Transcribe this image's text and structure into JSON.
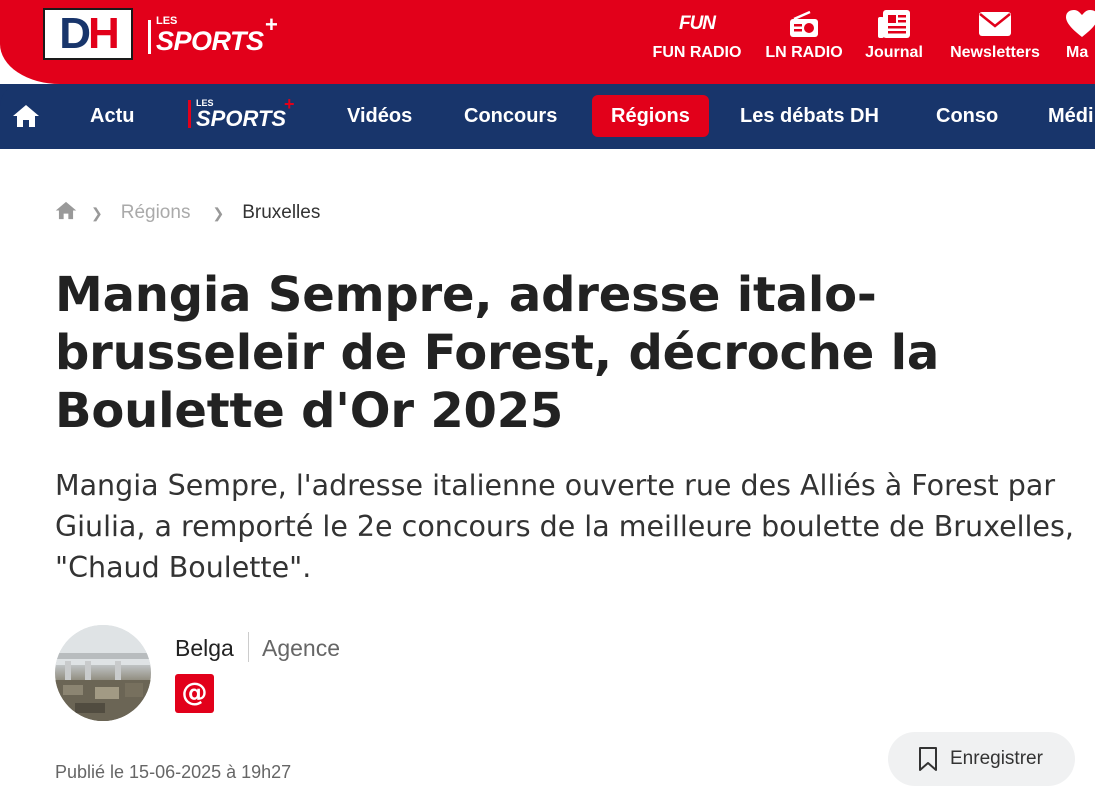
{
  "brand": {
    "logo_text": "DH",
    "sports_les": "LES",
    "sports_name": "SPORTS",
    "sports_plus": "+"
  },
  "colors": {
    "primary_red": "#e2001a",
    "navy": "#18356b"
  },
  "top_links": [
    {
      "label": "FUN RADIO",
      "icon": "fun-radio-logo-icon",
      "icon_text": "FUN"
    },
    {
      "label": "LN RADIO",
      "icon": "radio-icon"
    },
    {
      "label": "Journal",
      "icon": "newspaper-icon"
    },
    {
      "label": "Newsletters",
      "icon": "envelope-icon"
    },
    {
      "label": "Ma",
      "icon": "heart-icon"
    }
  ],
  "nav": {
    "items": [
      "Actu",
      "Vidéos",
      "Concours",
      "Régions",
      "Les débats DH",
      "Conso",
      "Médi"
    ],
    "active": "Régions"
  },
  "breadcrumb": {
    "items": [
      "Régions",
      "Bruxelles"
    ]
  },
  "article": {
    "title": "Mangia Sempre, adresse italo-brusseleir de Forest, décroche la Boulette d'Or 2025",
    "lead": "Mangia Sempre, l'adresse italienne ouverte rue des Alliés à Forest par Giulia, a remporté le 2e concours de la meilleure boulette de Bruxelles, \"Chaud Boulette\".",
    "author": {
      "name": "Belga",
      "role": "Agence",
      "contact_icon": "@"
    },
    "published": "Publié le 15-06-2025 à 19h27",
    "save_label": "Enregistrer"
  }
}
